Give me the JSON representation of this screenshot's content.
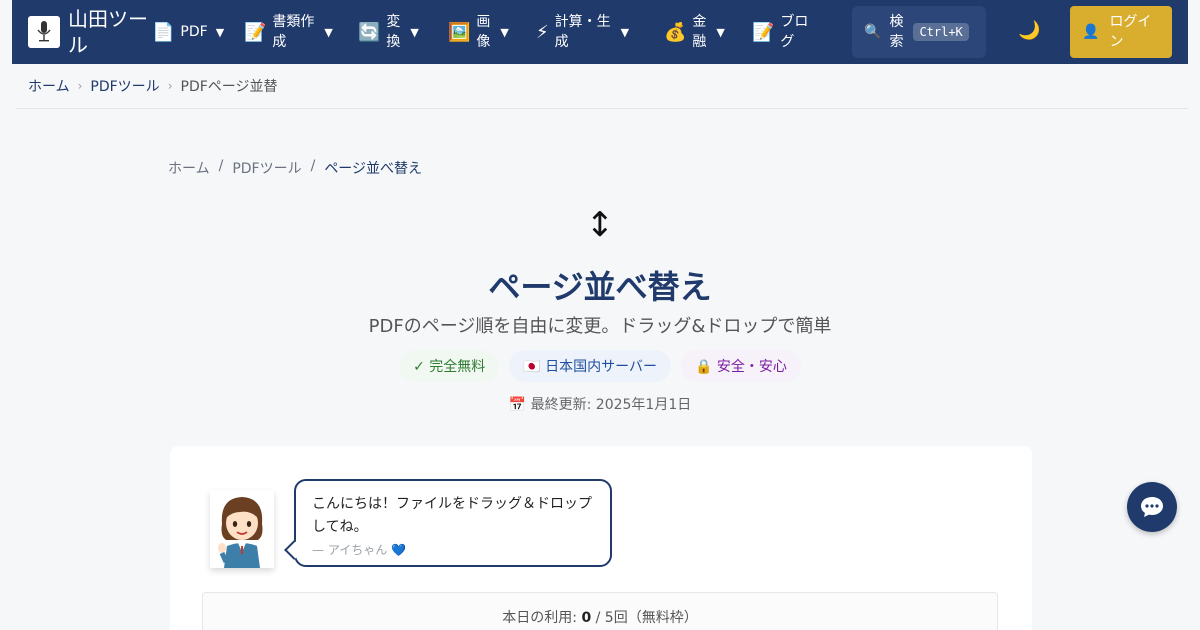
{
  "brand": {
    "name": "山田ツール"
  },
  "nav": {
    "items": [
      {
        "icon": "📄",
        "label": "PDF",
        "icon_name": "document-icon"
      },
      {
        "icon": "📝",
        "label": "書類作成",
        "icon_name": "memo-icon"
      },
      {
        "icon": "🔄",
        "label": "変換",
        "icon_name": "convert-icon"
      },
      {
        "icon": "🖼️",
        "label": "画像",
        "icon_name": "image-icon"
      },
      {
        "icon": "⚡",
        "label": "計算・生成",
        "icon_name": "lightning-icon"
      },
      {
        "icon": "💰",
        "label": "金融",
        "icon_name": "money-bag-icon"
      },
      {
        "icon": "📝",
        "label": "ブログ",
        "icon_name": "memo-icon"
      }
    ],
    "caret": "▼",
    "search_icon": "🔍",
    "search_label": "検索",
    "search_shortcut": "Ctrl+K",
    "theme_icon": "🌙",
    "login_icon": "👤",
    "login_label": "ログイン"
  },
  "breadcrumb_top": {
    "home": "ホーム",
    "category": "PDFツール",
    "current": "PDFページ並替",
    "separator": "›"
  },
  "breadcrumb_main": {
    "home": "ホーム",
    "category": "PDFツール",
    "current": "ページ並べ替え",
    "separator": "/"
  },
  "hero": {
    "icon": "↕",
    "title": "ページ並べ替え",
    "subtitle": "PDFのページ順を自由に変更。ドラッグ&ドロップで簡単",
    "badges": [
      {
        "text": "✓ 完全無料"
      },
      {
        "text": "🇯🇵 日本国内サーバー"
      },
      {
        "text": "🔒 安全・安心"
      }
    ],
    "updated": "📅 最終更新: 2025年1月1日"
  },
  "assistant": {
    "message": "こんにちは！ファイルをドラッグ＆ドロップしてね。",
    "signature": "— アイちゃん 💙"
  },
  "usage": {
    "prefix": "本日の利用: ",
    "used": "0",
    "suffix": " / 5回（無料枠）"
  },
  "colors": {
    "navbar": "#1f3a6b",
    "accent_gold": "#d9ae2e",
    "title": "#1f3a6b"
  }
}
